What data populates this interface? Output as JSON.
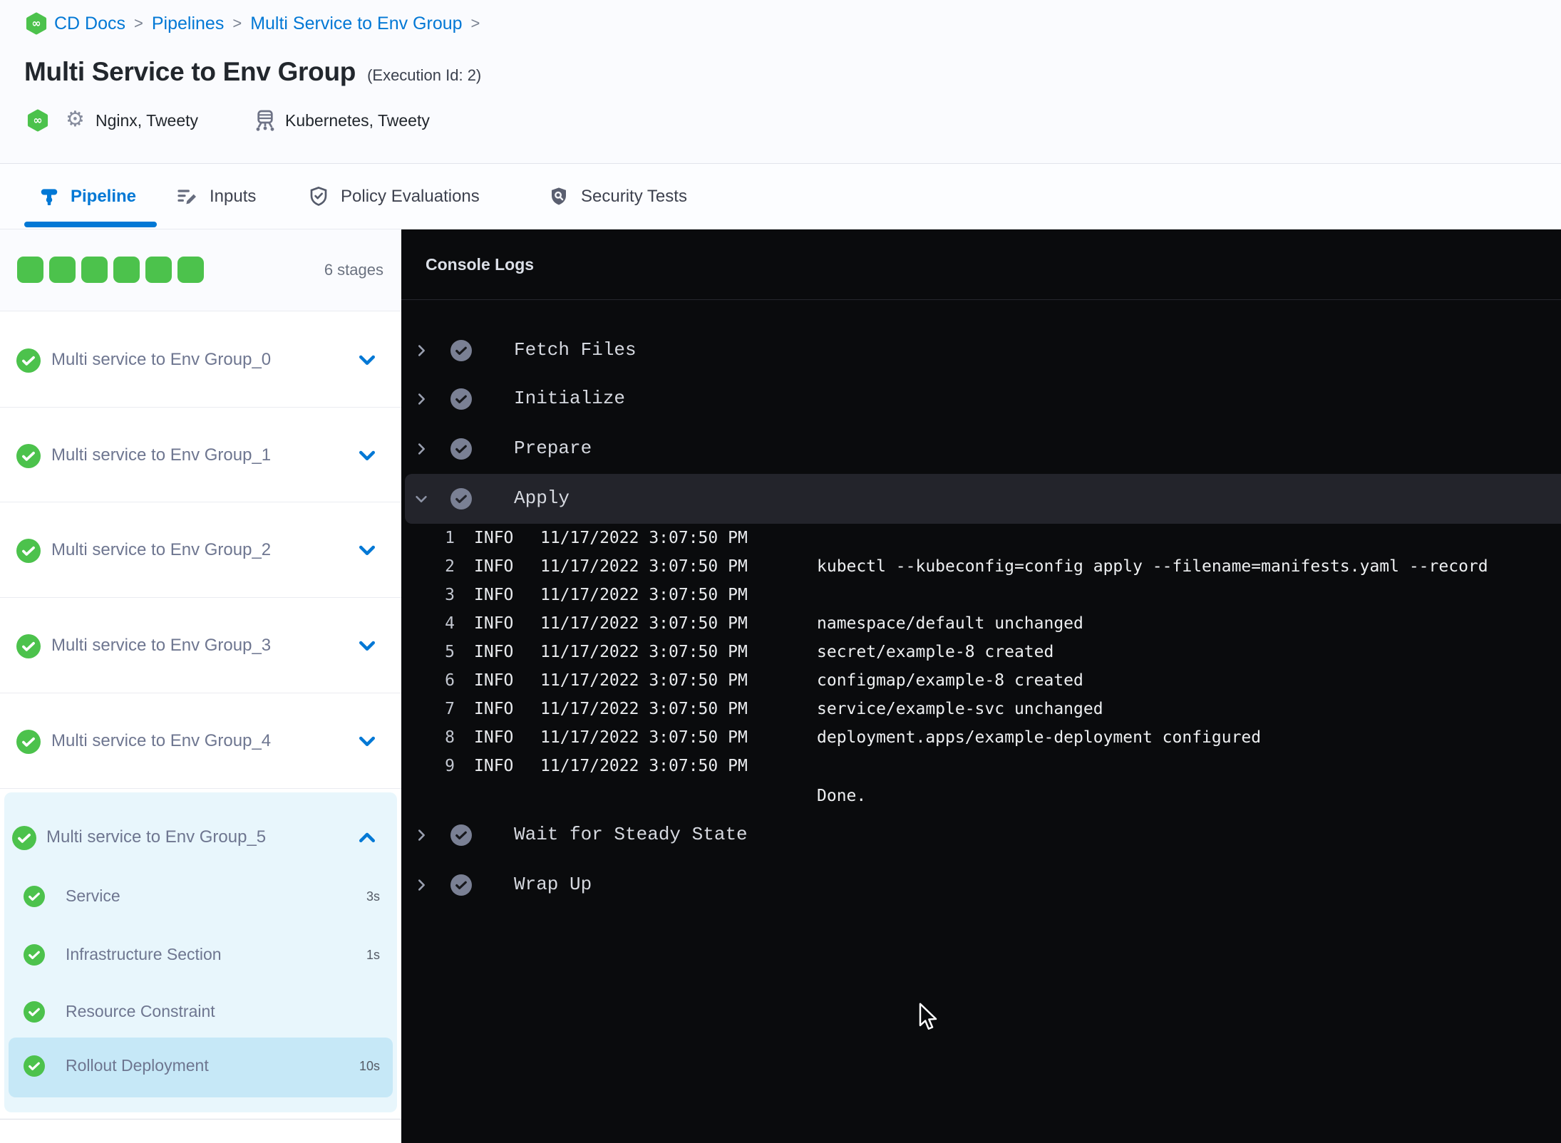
{
  "breadcrumb": {
    "separator": ">",
    "items": [
      "CD Docs",
      "Pipelines",
      "Multi Service to Env Group"
    ]
  },
  "header": {
    "title": "Multi Service to Env Group",
    "execution_id": "(Execution Id: 2)",
    "services": "Nginx, Tweety",
    "environments": "Kubernetes, Tweety"
  },
  "tabs": {
    "pipeline": "Pipeline",
    "inputs": "Inputs",
    "policy": "Policy Evaluations",
    "security": "Security Tests"
  },
  "sidebar": {
    "stage_count": "6 stages",
    "stages": [
      {
        "name": "Multi service to Env Group_0"
      },
      {
        "name": "Multi service to Env Group_1"
      },
      {
        "name": "Multi service to Env Group_2"
      },
      {
        "name": "Multi service to Env Group_3"
      },
      {
        "name": "Multi service to Env Group_4"
      }
    ],
    "expanded": {
      "name": "Multi service to Env Group_5",
      "selected_step": "Rollout Deployment",
      "steps": [
        {
          "name": "Service",
          "duration": "3s"
        },
        {
          "name": "Infrastructure Section",
          "duration": "1s"
        },
        {
          "name": "Resource Constraint",
          "duration": ""
        },
        {
          "name": "Rollout Deployment",
          "duration": "10s"
        }
      ]
    }
  },
  "console": {
    "title": "Console Logs",
    "steps": [
      {
        "name": "Fetch Files"
      },
      {
        "name": "Initialize"
      },
      {
        "name": "Prepare"
      }
    ],
    "expanded_step": {
      "name": "Apply"
    },
    "logs": [
      {
        "n": "1",
        "level": "INFO",
        "time": "11/17/2022 3:07:50 PM",
        "msg": ""
      },
      {
        "n": "2",
        "level": "INFO",
        "time": "11/17/2022 3:07:50 PM",
        "msg": "kubectl --kubeconfig=config apply --filename=manifests.yaml --record"
      },
      {
        "n": "3",
        "level": "INFO",
        "time": "11/17/2022 3:07:50 PM",
        "msg": ""
      },
      {
        "n": "4",
        "level": "INFO",
        "time": "11/17/2022 3:07:50 PM",
        "msg": "namespace/default unchanged"
      },
      {
        "n": "5",
        "level": "INFO",
        "time": "11/17/2022 3:07:50 PM",
        "msg": "secret/example-8 created"
      },
      {
        "n": "6",
        "level": "INFO",
        "time": "11/17/2022 3:07:50 PM",
        "msg": "configmap/example-8 created"
      },
      {
        "n": "7",
        "level": "INFO",
        "time": "11/17/2022 3:07:50 PM",
        "msg": "service/example-svc unchanged"
      },
      {
        "n": "8",
        "level": "INFO",
        "time": "11/17/2022 3:07:50 PM",
        "msg": "deployment.apps/example-deployment configured"
      },
      {
        "n": "9",
        "level": "INFO",
        "time": "11/17/2022 3:07:50 PM",
        "msg": ""
      }
    ],
    "done": "Done.",
    "steps_after": [
      {
        "name": "Wait for Steady State"
      },
      {
        "name": "Wrap Up"
      }
    ]
  },
  "colors": {
    "accent_blue": "#0278D5",
    "success_green": "#4CC24C",
    "console_bg": "#0A0B0D",
    "expanded_stage_bg": "#E8F6FC",
    "selected_step_bg": "#C6E8F7"
  }
}
